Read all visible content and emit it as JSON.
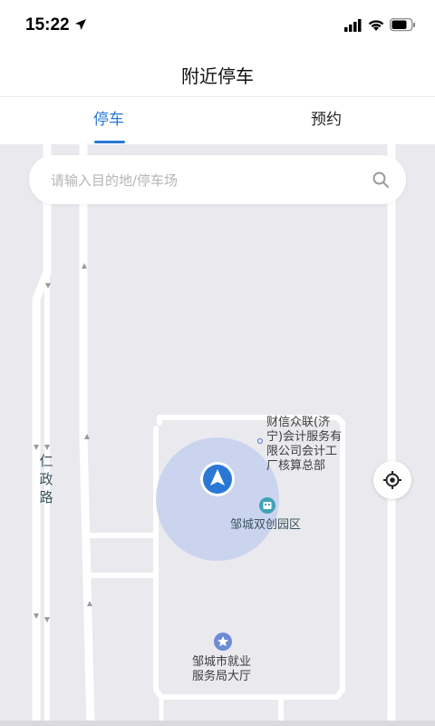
{
  "status_bar": {
    "time": "15:22",
    "icons": [
      "location-arrow-icon",
      "signal-icon",
      "wifi-icon",
      "battery-icon"
    ]
  },
  "header": {
    "title": "附近停车"
  },
  "tabs": [
    {
      "label": "停车",
      "active": true
    },
    {
      "label": "预约",
      "active": false
    }
  ],
  "search": {
    "placeholder": "请输入目的地/停车场"
  },
  "map": {
    "pois": [
      {
        "name": "财信众联(济宁)会计服务有限公司会计工厂核算总部"
      },
      {
        "name": "邹城双创园区"
      },
      {
        "name": "邹城市就业服务局大厅"
      }
    ],
    "roads": [
      {
        "name": "仁政路"
      }
    ],
    "colors": {
      "accent": "#2a78d6",
      "map_bg": "#eaeaee",
      "road": "#ffffff",
      "location_circle": "#c6d0ee",
      "poi_teal": "#3fa3b5",
      "poi_star": "#6e8bd6"
    }
  }
}
